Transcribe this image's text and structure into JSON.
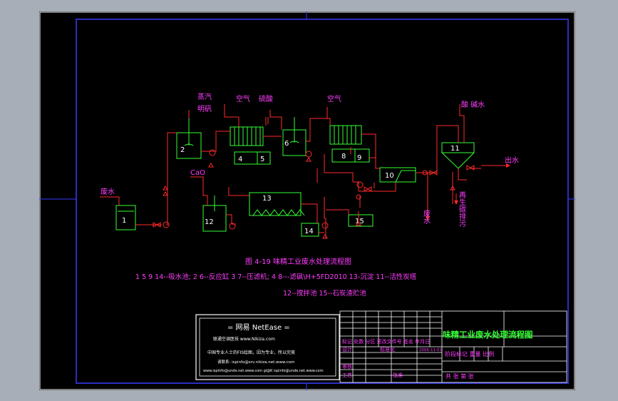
{
  "drawing": {
    "labels": {
      "steam": "蒸汽",
      "alum": "明矾",
      "air1": "空气",
      "sulfuric": "硫酸",
      "air2": "空气",
      "acid_water": "酸 碱水",
      "outlet": "出水",
      "wastewater": "废水",
      "cao": "CaO",
      "regen": "再生碳排污",
      "waste_liquid": "废水"
    },
    "units": [
      "1",
      "2",
      "4",
      "5",
      "6",
      "8",
      "9",
      "10",
      "11",
      "12",
      "13",
      "14",
      "15"
    ],
    "caption": {
      "title": "图 4-19 味精工业废水处理流程图",
      "legend1": "1 5 9 14--吸水池; 2 6--反应缸 3 7--压滤机; 4 8---滤砜\\H+5FD2010 13-沉淀 11--活性炭塔",
      "legend2": "12--搅拌池 15--石炭渣贮池"
    },
    "netease": {
      "title": "= 网易 NetEase =",
      "line1": "联通空调医技   www.Nikiza.com",
      "line2": "中国专业人士的FIS绘图，因为专业，所以完美",
      "line3": "请联系: ispinfo@srv.nikiza.net.www.com",
      "line4": "www.ispinfo@unde.net.www.com   gi@K ispinfo@unde.net.www.com"
    },
    "title_block": {
      "drawing_title": "味精工业废水处理流程图",
      "rev_header": "标记 处数 分区 更改文件号 签名 年月日",
      "design": "设计",
      "standard": "标准化",
      "date": "2006-11-01",
      "stage": "阶段标记 重量 比例",
      "review": "审核",
      "process": "工艺",
      "approve": "批准",
      "sheets": "共 张 第 张"
    }
  }
}
